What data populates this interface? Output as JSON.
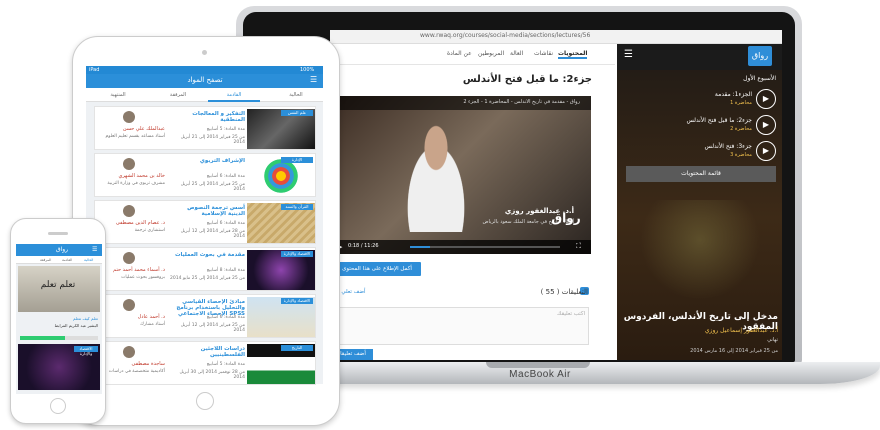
{
  "laptop": {
    "model_label": "MacBook Air",
    "url": "www.rwaq.org/courses/social-media/sections/lectures/56",
    "tabs": [
      "المحتويات",
      "نقاشات",
      "العالة",
      "المربوطين",
      "عن المادة"
    ],
    "logo": "رواق",
    "week_label": "الأسبوع الأول",
    "lectures": [
      {
        "title": "الجزء1: مقدمة",
        "sub": "محاضرة 1"
      },
      {
        "title": "جزء2: ما قبل فتح الأندلس",
        "sub": "محاضرة 2"
      },
      {
        "title": "جزء3: فتح الأندلس",
        "sub": "محاضرة 3"
      }
    ],
    "show_all_label": "قائمة المحتويات",
    "course_title": "مدخل إلى تاريخ الأندلس، الفردوس المفقود",
    "instructor": "أ.د. عبدالغفور إسماعيل روزي",
    "university": "تهاني",
    "date": "من 25 فبراير 2014 إلى 16 مارس 2014",
    "lecture_title": "جزء2: ما قبل فتح الأندلس",
    "video_bar_text": "رواق - مقدمة في تاريخ الأندلس - المحاضرة 1 - الجزء 2",
    "video_caption": "أ.د. عبدالغفور روزي",
    "video_sub": "أستاذ التاريخ في جامعة الملك سعود بالرياض",
    "video_logo": "رواق",
    "video_time": "0:18 / 11:26",
    "video_progress": 0.13,
    "more_button": "أكمل الإطلاع على هذا المحتوى",
    "comments_label": "التعليقات ( 55 )",
    "add_comment": "+ أضف تعلي",
    "comment_placeholder": "اكتب تعليقك",
    "submit_label": "أضف تعليقا"
  },
  "tablet": {
    "status_left": "iPad",
    "status_right": "100%",
    "header_title": "تصفح المواد",
    "tabs": [
      "الحالية",
      "القادمة",
      "المرفقة",
      "المنتهية"
    ],
    "courses": [
      {
        "tag": "علم النفس",
        "title": "التفكير و المعالجات المنطقية",
        "meta1": "مدة المادة: 5 أسابيع",
        "meta2": "من 25 فبراير 2014 إلى 21 أبريل 2014",
        "name": "عبدالملك علي حسن",
        "role": "أستاذ مساعد بقسم تعليم العلوم"
      },
      {
        "tag": "الإدارة",
        "title": "الإشراف التربوي",
        "meta1": "مدة المادة: 6 أسابيع",
        "meta2": "من 25 فبراير 2014 إلى 25 أبريل 2014",
        "name": "خالد بن محمد الشهري",
        "role": "مشرف تربوي في وزارة التربية"
      },
      {
        "tag": "القرآن والسنة",
        "title": "أسس ترجمة النصوص الدينية الإسلامية",
        "meta1": "مدة المادة: 6 أسابيع",
        "meta2": "من 28 فبراير 2014 إلى 12 أبريل 2014",
        "name": "د. عصام الدين مصطفى",
        "role": "استشاري ترجمة"
      },
      {
        "tag": "الاقتصاد والإدارة",
        "title": "مقدمة في بحوث العمليات",
        "meta1": "مدة المادة: 8 أسابيع",
        "meta2": "من 25 فبراير 2014 إلى 25 مايو 2014",
        "name": "د. أسماء محمد أحمد حتم",
        "role": "بروفسور بحوث عمليات"
      },
      {
        "tag": "الاقتصاد والإدارة",
        "title": "مبادئ الإحصاء القياسي والتحليل باستخدام برنامج الإحصاء الاجتماعي SPSS",
        "meta1": "مدة المادة: 6 أسابيع",
        "meta2": "من 25 فبراير 2014 إلى 12 أبريل 2014",
        "name": "د. أحمد عادل",
        "role": "أستاذ مشارك"
      },
      {
        "tag": "التاريخ",
        "title": "دراسات اللاجئين الفلسطينيين",
        "meta1": "مدة المادة: 5 أسابيع",
        "meta2": "من 28 نوفمبر 2014 إلى 30 أبريل 2014",
        "name": "ساجدة مصطفى",
        "role": "أكاديمية متخصصة في دراسات"
      }
    ]
  },
  "phone": {
    "logo": "رواق",
    "tabs": [
      "الحالية",
      "القادمة",
      "المرفقة"
    ],
    "img_text": "تعلم تعلم",
    "title1": "تعلم كيف تتعلم",
    "name1": "البشير عبد الكريم المرابط",
    "progress": 0.58,
    "tag2": "الاقتصاد والإدارة"
  },
  "colors": {
    "accent": "#2b8fd9",
    "name_red": "#c0392b",
    "progress_green": "#2ecc71"
  }
}
